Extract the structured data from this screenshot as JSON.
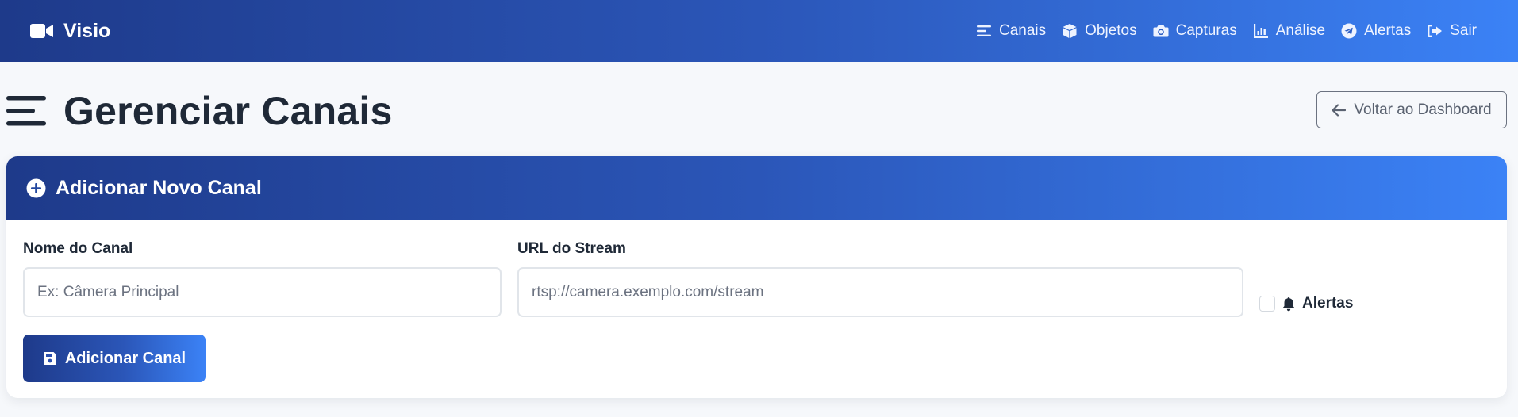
{
  "navbar": {
    "brand": "Visio",
    "brand_icon": "video-camera-icon",
    "links": [
      {
        "label": "Canais",
        "icon": "list-icon"
      },
      {
        "label": "Objetos",
        "icon": "cube-icon"
      },
      {
        "label": "Capturas",
        "icon": "camera-icon"
      },
      {
        "label": "Análise",
        "icon": "chart-icon"
      },
      {
        "label": "Alertas",
        "icon": "telegram-icon"
      },
      {
        "label": "Sair",
        "icon": "sign-out-icon"
      }
    ]
  },
  "page": {
    "title": "Gerenciar Canais",
    "title_icon": "bars-icon",
    "back_button": "Voltar ao Dashboard"
  },
  "card": {
    "title": "Adicionar Novo Canal",
    "name_label": "Nome do Canal",
    "name_placeholder": "Ex: Câmera Principal",
    "name_value": "",
    "url_label": "URL do Stream",
    "url_placeholder": "rtsp://camera.exemplo.com/stream",
    "url_value": "",
    "alerts_label": "Alertas",
    "alerts_checked": false,
    "submit_label": "Adicionar Canal"
  },
  "colors": {
    "primary_dark": "#1e3a8a",
    "primary_light": "#3b82f6",
    "background": "#f6f8fb",
    "text": "#1f2937"
  }
}
